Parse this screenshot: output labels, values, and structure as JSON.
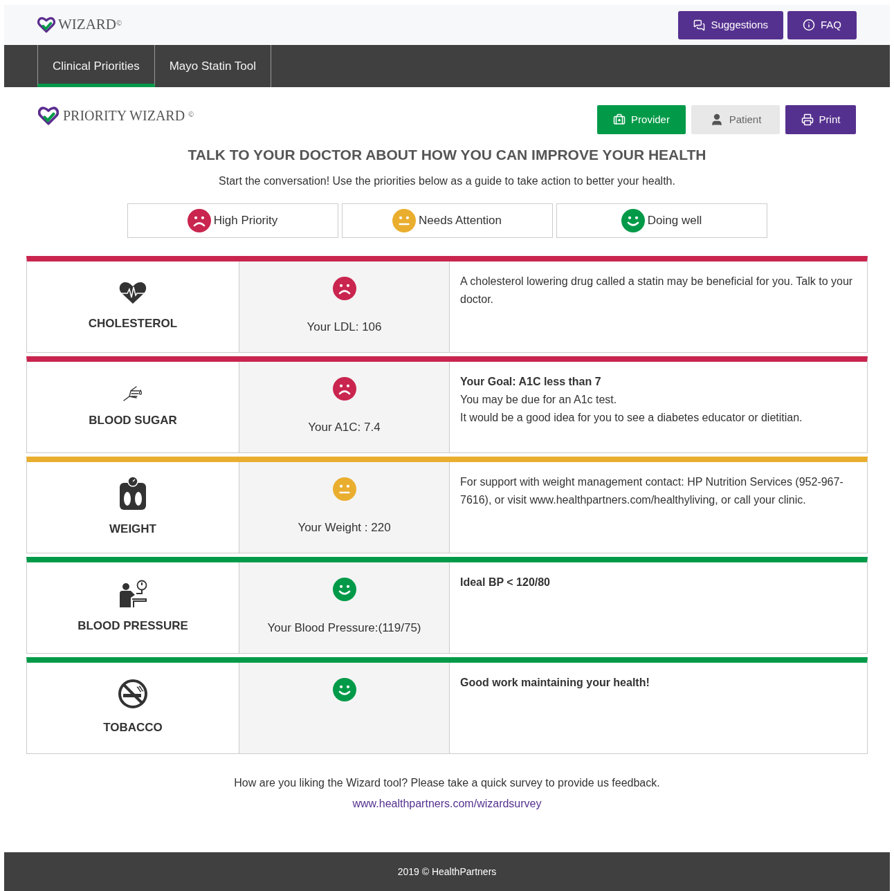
{
  "header": {
    "logo": "WIZARD",
    "logo_mark": "©",
    "buttons": [
      {
        "label": "Suggestions",
        "kind": "chat"
      },
      {
        "label": "FAQ",
        "kind": "info"
      }
    ]
  },
  "tabs": [
    {
      "label": "Clinical Priorities",
      "selected": true
    },
    {
      "label": "Mayo Statin Tool",
      "selected": false
    }
  ],
  "brand": {
    "title": "PRIORITY WIZARD",
    "mark": "©"
  },
  "views": [
    {
      "label": "Provider",
      "kind": "provider",
      "selected": true
    },
    {
      "label": "Patient",
      "kind": "patient",
      "selected": false
    }
  ],
  "print_button": "Print",
  "heading": "TALK TO YOUR DOCTOR ABOUT HOW YOU CAN IMPROVE YOUR HEALTH",
  "subheading": "Start the conversation! Use the priorities below as a guide to take action to better your health.",
  "legend": [
    {
      "label": "High Priority",
      "face": {
        "kind": "sad",
        "color": "#c9254f"
      }
    },
    {
      "label": "Needs Attention",
      "face": {
        "kind": "neutral",
        "color": "#eaae2f"
      }
    },
    {
      "label": "Doing well",
      "face": {
        "kind": "happy",
        "color": "#029a48"
      }
    }
  ],
  "rows": [
    {
      "name": "CHOLESTEROL",
      "kind": "heart",
      "color": "#c9254f",
      "face": {
        "kind": "sad",
        "color": "#c9254f"
      },
      "reading": "Your LDL: 106",
      "message": [
        {
          "text": "A cholesterol lowering drug called a statin may be beneficial for you. Talk to your doctor.",
          "bold": false
        }
      ]
    },
    {
      "name": "BLOOD SUGAR",
      "kind": "finger",
      "color": "#c9254f",
      "face": {
        "kind": "sad",
        "color": "#c9254f"
      },
      "reading": "Your A1C: 7.4",
      "message": [
        {
          "text": "Your Goal: A1C less than 7",
          "bold": true
        },
        {
          "text": "You may be due for an A1c test.",
          "bold": false
        },
        {
          "text": "It would be a good idea for you to see a diabetes educator or dietitian.",
          "bold": false
        }
      ]
    },
    {
      "name": "WEIGHT",
      "kind": "scale",
      "color": "#eaae2f",
      "face": {
        "kind": "neutral",
        "color": "#eaae2f"
      },
      "reading": "Your Weight : 220",
      "message": [
        {
          "text": "For support with weight management contact: HP Nutrition Services (952-967-7616), or visit www.healthpartners.com/healthyliving, or call your clinic.",
          "bold": false
        }
      ]
    },
    {
      "name": "BLOOD PRESSURE",
      "kind": "bp",
      "color": "#029a48",
      "face": {
        "kind": "happy",
        "color": "#029a48"
      },
      "reading": "Your Blood Pressure:(119/75)",
      "message": [
        {
          "text": "Ideal BP < 120/80",
          "bold": true
        }
      ]
    },
    {
      "name": "TOBACCO",
      "kind": "nosmoke",
      "color": "#029a48",
      "face": {
        "kind": "happy",
        "color": "#029a48"
      },
      "message": [
        {
          "text": "Good work maintaining your health!",
          "bold": true
        }
      ]
    }
  ],
  "survey": {
    "text": "How are you liking the Wizard tool? Please take a quick survey to provide us feedback.",
    "link": "www.healthpartners.com/wizardsurvey"
  },
  "footer": "2019 © HealthPartners"
}
